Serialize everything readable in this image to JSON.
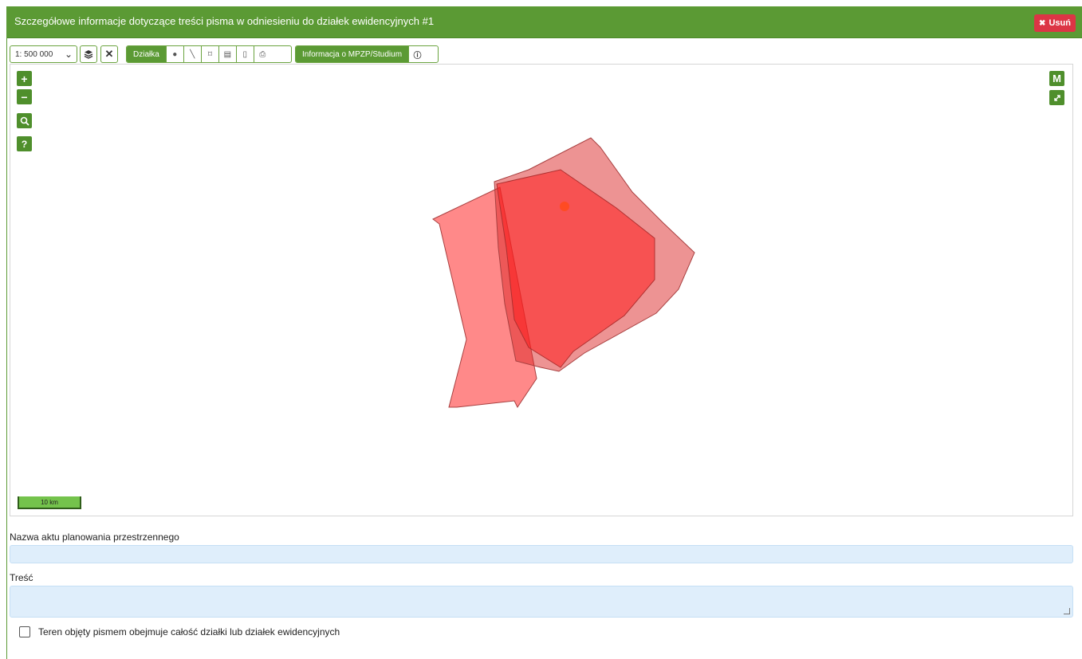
{
  "panel": {
    "title": "Szczegółowe informacje dotyczące treści pisma w odniesieniu do działek ewidencyjnych #1",
    "delete_label": "Usuń",
    "header_color": "#5b9a34",
    "delete_color": "#dc3545"
  },
  "toolbar": {
    "scale_value": "1: 500 000",
    "layers_icon": "layers-icon",
    "clear_icon": "close-icon",
    "parcel_group_label": "Działka",
    "parcel_tools": [
      "point-icon",
      "line-icon",
      "polygon-icon",
      "table-icon",
      "document-icon",
      "pdf-icon"
    ],
    "mpzp_label": "Informacja o MPZP/Studium",
    "info_icon": "info-icon"
  },
  "map": {
    "zoom_in": "+",
    "zoom_out": "−",
    "search_icon": "search-icon",
    "help_label": "?",
    "m_label": "M",
    "fullscreen_icon": "fullscreen-icon",
    "scale_bar_label": "10 km",
    "polygon_color": "#ff2020"
  },
  "form": {
    "plan_name_label": "Nazwa aktu planowania przestrzennego",
    "plan_name_value": "",
    "content_label": "Treść",
    "content_value": "",
    "whole_parcel_label": "Teren objęty pismem obejmuje całość działki lub działek ewidencyjnych",
    "whole_parcel_checked": false
  }
}
